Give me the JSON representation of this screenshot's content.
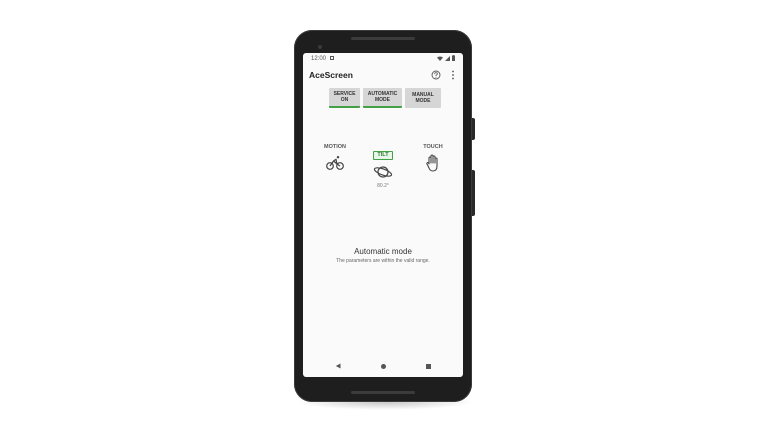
{
  "status_bar": {
    "time": "12:00",
    "icons": [
      "wifi-icon",
      "signal-icon",
      "battery-icon"
    ]
  },
  "app": {
    "title": "AceScreen",
    "actions": [
      "help-icon",
      "more-vert-icon"
    ]
  },
  "mode_buttons": [
    {
      "label": "SERVICE\nON",
      "active": true
    },
    {
      "label": "AUTOMATIC\nMODE",
      "active": true
    },
    {
      "label": "MANUAL\nMODE",
      "active": false
    }
  ],
  "sensors": [
    {
      "label": "MOTION",
      "icon": "bicycle-icon",
      "value": "",
      "highlighted": false
    },
    {
      "label": "TILT",
      "icon": "planet-icon",
      "value": "80.2°",
      "highlighted": true
    },
    {
      "label": "TOUCH",
      "icon": "hand-icon",
      "value": "",
      "highlighted": false
    }
  ],
  "status": {
    "title": "Automatic mode",
    "description": "The parameters are within the valid range."
  },
  "nav_bar": [
    "back-icon",
    "home-icon",
    "recents-icon"
  ],
  "colors": {
    "accent": "#43a047",
    "button_bg": "#d6d6d6",
    "phone_body": "#1e1e1e"
  }
}
